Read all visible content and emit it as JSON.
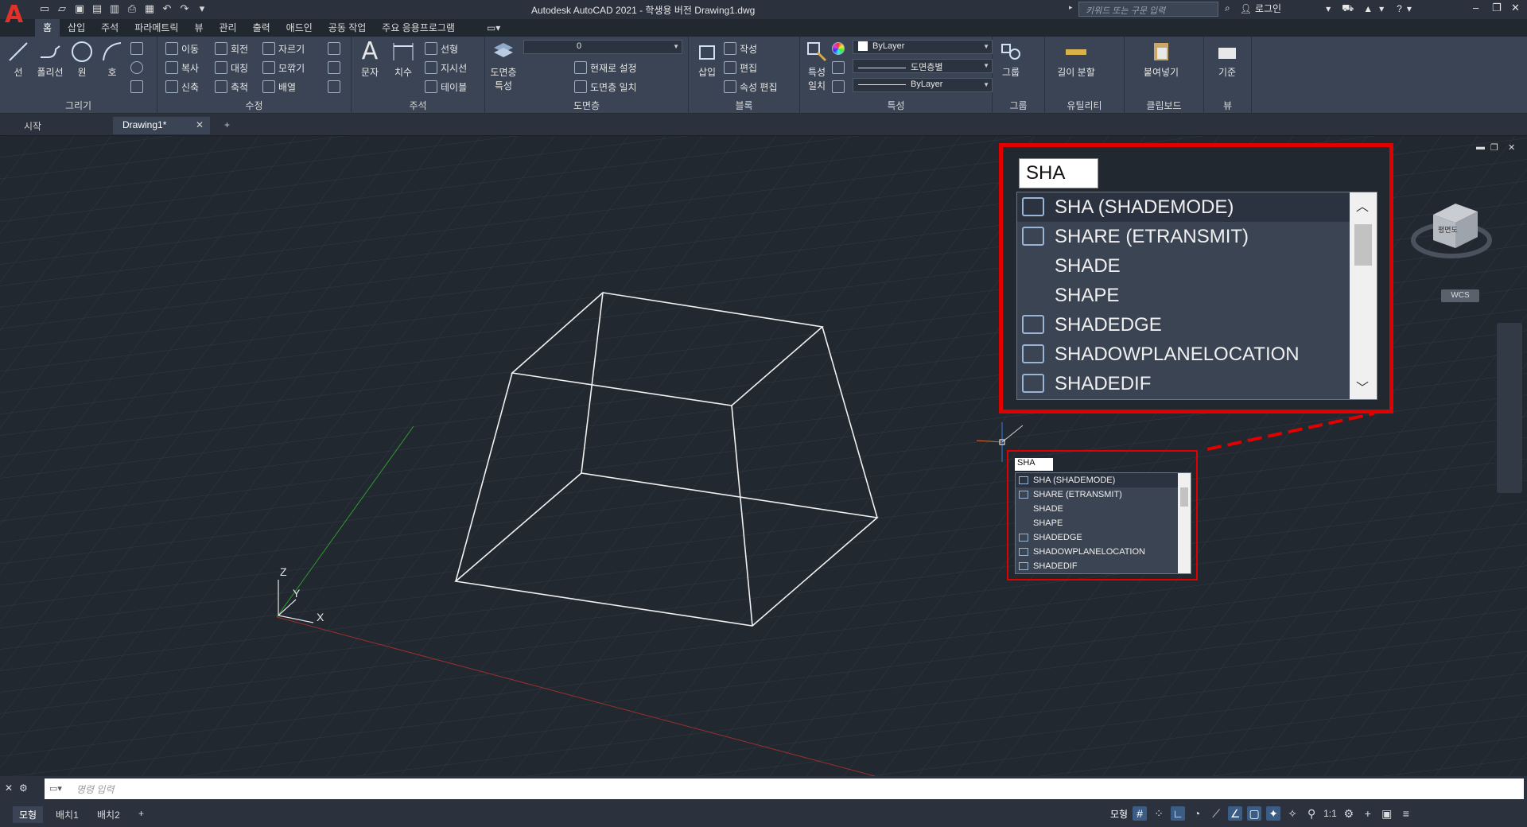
{
  "title_bar": {
    "app_title": "Autodesk AutoCAD 2021 - 학생용 버전    Drawing1.dwg",
    "search_placeholder": "키워드 또는 구문 입력",
    "login": "로그인"
  },
  "menu_tabs": [
    "홈",
    "삽입",
    "주석",
    "파라메트릭",
    "뷰",
    "관리",
    "출력",
    "애드인",
    "공동 작업",
    "주요 응용프로그램"
  ],
  "ribbon": {
    "draw": {
      "label": "그리기",
      "line": "선",
      "polyline": "폴리선",
      "circle": "원",
      "arc": "호"
    },
    "modify": {
      "label": "수정",
      "move": "이동",
      "rotate": "회전",
      "trim": "자르기",
      "copy": "복사",
      "mirror": "대칭",
      "fillet": "모깎기",
      "stretch": "신축",
      "scale": "축척",
      "array": "배열"
    },
    "annotation": {
      "label": "주석",
      "text": "문자",
      "dimension": "치수",
      "linear": "선형",
      "leader": "지시선",
      "table": "테이블"
    },
    "layers": {
      "label": "도면층",
      "properties": "도면층\n특성",
      "current_layer": "0",
      "make_current": "현재로 설정",
      "match": "도면층 일치"
    },
    "block": {
      "label": "블록",
      "insert": "삽입",
      "create": "작성",
      "edit": "편집",
      "edit_attr": "속성 편집"
    },
    "properties": {
      "label": "특성",
      "match": "특성\n일치",
      "color": "ByLayer",
      "linetype": "도면층별",
      "lineweight": "ByLayer"
    },
    "groups": {
      "label": "그룹",
      "group": "그룹"
    },
    "utilities": {
      "label": "유틸리티",
      "measure": "길이 분할"
    },
    "clipboard": {
      "label": "클립보드",
      "paste": "붙여넣기"
    },
    "view": {
      "label": "뷰",
      "base": "기준"
    }
  },
  "doc_tabs": {
    "start": "시작",
    "drawing": "Drawing1*"
  },
  "autocomplete": {
    "input": "SHA",
    "items": [
      {
        "label": "SHA (SHADEMODE)",
        "icon": "shademode-icon"
      },
      {
        "label": "SHARE (ETRANSMIT)",
        "icon": "etransmit-icon"
      },
      {
        "label": "SHADE",
        "icon": ""
      },
      {
        "label": "SHAPE",
        "icon": ""
      },
      {
        "label": "SHADEDGE",
        "icon": "sysvar-icon"
      },
      {
        "label": "SHADOWPLANELOCATION",
        "icon": "sysvar-icon"
      },
      {
        "label": "SHADEDIF",
        "icon": "sysvar-icon"
      }
    ]
  },
  "viewcube": {
    "face": "평면도",
    "wcs": "WCS"
  },
  "ucs": {
    "x": "X",
    "y": "Y",
    "z": "Z"
  },
  "command_line": {
    "placeholder": "명령 입력"
  },
  "layout_tabs": [
    "모형",
    "배치1",
    "배치2"
  ],
  "status": {
    "model": "모형",
    "scale": "1:1"
  }
}
